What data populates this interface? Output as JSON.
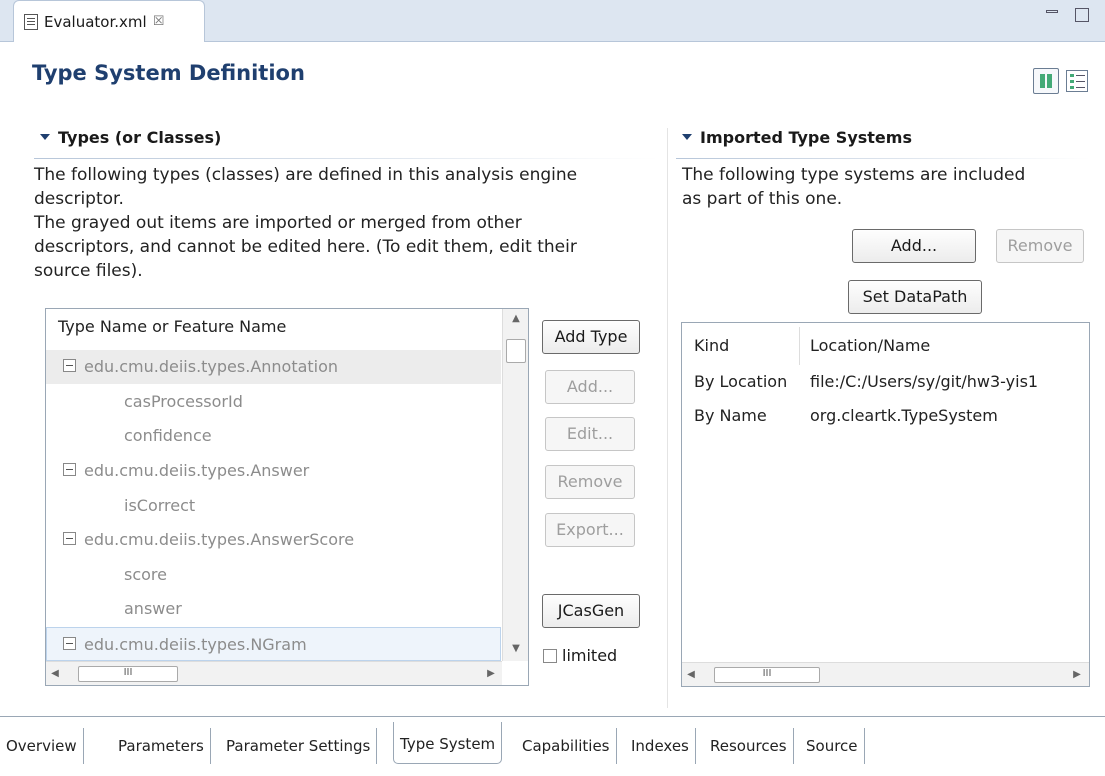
{
  "editor": {
    "tab_label": "Evaluator.xml",
    "close_glyph": "☒",
    "minimize_glyph": "▭",
    "maximize_glyph": ""
  },
  "page": {
    "title": "Type System Definition"
  },
  "types_section": {
    "title": "Types (or Classes)",
    "desc_1": "The following types (classes) are defined in this analysis engine",
    "desc_2": "descriptor.",
    "desc_3": "The grayed out items are imported or merged from other",
    "desc_4": "descriptors, and cannot be edited here. (To edit them, edit their",
    "desc_5": "source files).",
    "column_header": "Type Name or Feature Name",
    "rows": [
      {
        "label": "edu.cmu.deiis.types.Annotation",
        "kind": "type"
      },
      {
        "label": "casProcessorId",
        "kind": "feature"
      },
      {
        "label": "confidence",
        "kind": "feature"
      },
      {
        "label": "edu.cmu.deiis.types.Answer",
        "kind": "type"
      },
      {
        "label": "isCorrect",
        "kind": "feature"
      },
      {
        "label": "edu.cmu.deiis.types.AnswerScore",
        "kind": "type"
      },
      {
        "label": "score",
        "kind": "feature"
      },
      {
        "label": "answer",
        "kind": "feature"
      },
      {
        "label": "edu.cmu.deiis.types.NGram",
        "kind": "type"
      }
    ],
    "buttons": {
      "add_type": "Add Type",
      "add": "Add...",
      "edit": "Edit...",
      "remove": "Remove",
      "export": "Export...",
      "jcasgen": "JCasGen",
      "limited": "limited"
    },
    "hscroll_glyph": "III"
  },
  "imports_section": {
    "title": "Imported Type Systems",
    "desc_1": "The following type systems are included",
    "desc_2": "as part of this one.",
    "buttons": {
      "add": "Add...",
      "remove": "Remove",
      "set_datapath": "Set DataPath"
    },
    "table": {
      "headers": [
        "Kind",
        "Location/Name"
      ],
      "rows": [
        [
          "By Location",
          "file:/C:/Users/sy/git/hw3-yis1"
        ],
        [
          "By Name",
          "org.cleartk.TypeSystem"
        ]
      ]
    },
    "hscroll_glyph": "III"
  },
  "bottom_tabs": [
    {
      "label": "Overview",
      "active": false
    },
    {
      "label": "Parameters",
      "active": false
    },
    {
      "label": "Parameter Settings",
      "active": false
    },
    {
      "label": "Type System",
      "active": true
    },
    {
      "label": "Capabilities",
      "active": false
    },
    {
      "label": "Indexes",
      "active": false
    },
    {
      "label": "Resources",
      "active": false
    },
    {
      "label": "Source",
      "active": false
    }
  ]
}
